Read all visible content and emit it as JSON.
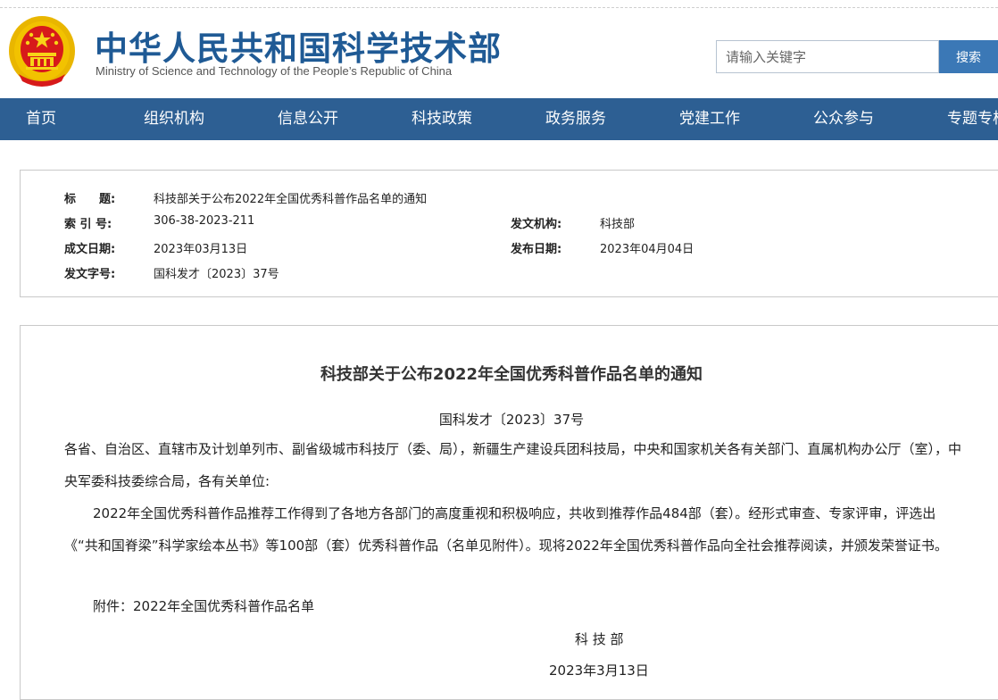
{
  "header": {
    "title": "中华人民共和国科学技术部",
    "subtitle": "Ministry of Science and Technology of the People’s Republic of China",
    "emblem_icon": "national-emblem",
    "search": {
      "placeholder": "请输入关键字",
      "button_label": "搜索"
    }
  },
  "nav": {
    "items": [
      {
        "label": "首页"
      },
      {
        "label": "组织机构"
      },
      {
        "label": "信息公开"
      },
      {
        "label": "科技政策"
      },
      {
        "label": "政务服务"
      },
      {
        "label": "党建工作"
      },
      {
        "label": "公众参与"
      },
      {
        "label": "专题专栏"
      }
    ]
  },
  "meta": {
    "title_label": "标　　题:",
    "title_value": "科技部关于公布2022年全国优秀科普作品名单的通知",
    "index_label": "索 引 号:",
    "index_value": "306-38-2023-211",
    "org_label": "发文机构:",
    "org_value": "科技部",
    "written_label": "成文日期:",
    "written_value": "2023年03月13日",
    "published_label": "发布日期:",
    "published_value": "2023年04月04日",
    "docno_label": "发文字号:",
    "docno_value": "国科发才〔2023〕37号"
  },
  "article": {
    "title": "科技部关于公布2022年全国优秀科普作品名单的通知",
    "doc_number": "国科发才〔2023〕37号",
    "recipients": "各省、自治区、直辖市及计划单列市、副省级城市科技厅（委、局），新疆生产建设兵团科技局，中央和国家机关各有关部门、直属机构办公厅（室），中央军委科技委综合局，各有关单位:",
    "body": "2022年全国优秀科普作品推荐工作得到了各地方各部门的高度重视和积极响应，共收到推荐作品484部（套）。经形式审查、专家评审，评选出《“共和国脊梁”科学家绘本丛书》等100部（套）优秀科普作品（名单见附件）。现将2022年全国优秀科普作品向全社会推荐阅读，并颁发荣誉证书。",
    "attachment": "附件：2022年全国优秀科普作品名单",
    "signer": "科 技 部",
    "date": "2023年3月13日"
  },
  "colors": {
    "brand_blue": "#1f5a95",
    "nav_blue": "#2d5f93",
    "button_blue": "#3b78b6",
    "emblem_red": "#d71a1a",
    "emblem_gold": "#f2c200"
  }
}
